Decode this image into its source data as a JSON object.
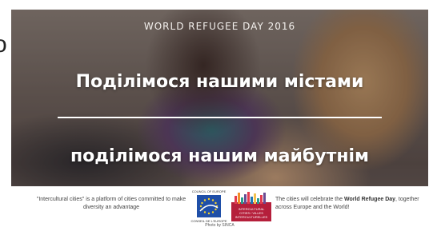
{
  "banner": {
    "event_title": "WORLD REFUGEE DAY 2016",
    "headline_line1": "Поділімося нашими містами",
    "headline_line2": "поділімося нашим майбутнім"
  },
  "footer": {
    "left_text": "\"Intercultural cities\" is a platform of cities committed to make diversity an advantage",
    "right_text_prefix": "The cities will celebrate the ",
    "right_text_bold": "World Refugee Day",
    "right_text_suffix": ", together across Europe and the World!",
    "coe_logo_top": "COUNCIL OF EUROPE",
    "coe_logo_bottom": "CONSEIL DE L'EUROPE",
    "icc_logo_text": "INTERCULTURAL CITIES / VILLES INTERCULTURELLES",
    "photo_credit": "Photo by SINCA"
  },
  "colors": {
    "coe_blue": "#1f4fa8",
    "icc_red": "#b51f3b",
    "headline_text": "#ffffff"
  },
  "left_edge_glyph": "o"
}
